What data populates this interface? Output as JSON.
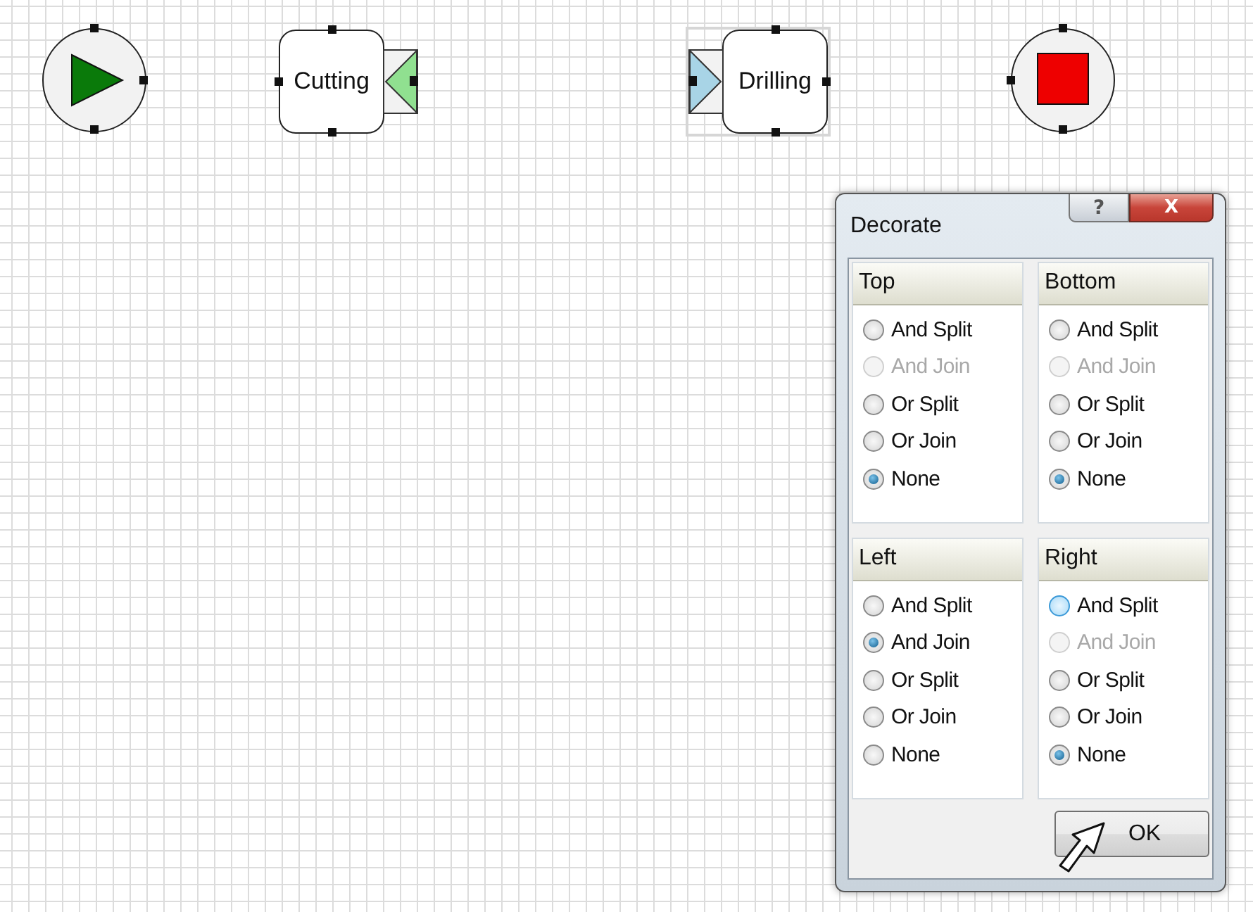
{
  "nodes": [
    {
      "kind": "start",
      "selected": false
    },
    {
      "kind": "task",
      "label": "Cutting",
      "selected": false,
      "decoration": {
        "kind": "right",
        "color": "#90e090"
      }
    },
    {
      "kind": "task",
      "label": "Drilling",
      "selected": true,
      "decoration": {
        "kind": "left",
        "color": "#a8d4e6"
      }
    },
    {
      "kind": "end",
      "selected": false
    }
  ],
  "dialog": {
    "title": "Decorate",
    "help_button": "?",
    "close_button": "X",
    "groups": [
      {
        "title": "Top",
        "options": [
          {
            "label": "And Split",
            "selected": false,
            "disabled": false,
            "hovered": false
          },
          {
            "label": "And Join",
            "selected": false,
            "disabled": true,
            "hovered": false
          },
          {
            "label": "Or Split",
            "selected": false,
            "disabled": false,
            "hovered": false
          },
          {
            "label": "Or Join",
            "selected": false,
            "disabled": false,
            "hovered": false
          },
          {
            "label": "None",
            "selected": true,
            "disabled": false,
            "hovered": false
          }
        ]
      },
      {
        "title": "Bottom",
        "options": [
          {
            "label": "And Split",
            "selected": false,
            "disabled": false,
            "hovered": false
          },
          {
            "label": "And Join",
            "selected": false,
            "disabled": true,
            "hovered": false
          },
          {
            "label": "Or Split",
            "selected": false,
            "disabled": false,
            "hovered": false
          },
          {
            "label": "Or Join",
            "selected": false,
            "disabled": false,
            "hovered": false
          },
          {
            "label": "None",
            "selected": true,
            "disabled": false,
            "hovered": false
          }
        ]
      },
      {
        "title": "Left",
        "options": [
          {
            "label": "And Split",
            "selected": false,
            "disabled": false,
            "hovered": false
          },
          {
            "label": "And Join",
            "selected": true,
            "disabled": false,
            "hovered": false
          },
          {
            "label": "Or Split",
            "selected": false,
            "disabled": false,
            "hovered": false
          },
          {
            "label": "Or Join",
            "selected": false,
            "disabled": false,
            "hovered": false
          },
          {
            "label": "None",
            "selected": false,
            "disabled": false,
            "hovered": false
          }
        ]
      },
      {
        "title": "Right",
        "options": [
          {
            "label": "And Split",
            "selected": false,
            "disabled": false,
            "hovered": true
          },
          {
            "label": "And Join",
            "selected": false,
            "disabled": true,
            "hovered": false
          },
          {
            "label": "Or Split",
            "selected": false,
            "disabled": false,
            "hovered": false
          },
          {
            "label": "Or Join",
            "selected": false,
            "disabled": false,
            "hovered": false
          },
          {
            "label": "None",
            "selected": true,
            "disabled": false,
            "hovered": false
          }
        ]
      }
    ],
    "ok_button": "OK"
  }
}
